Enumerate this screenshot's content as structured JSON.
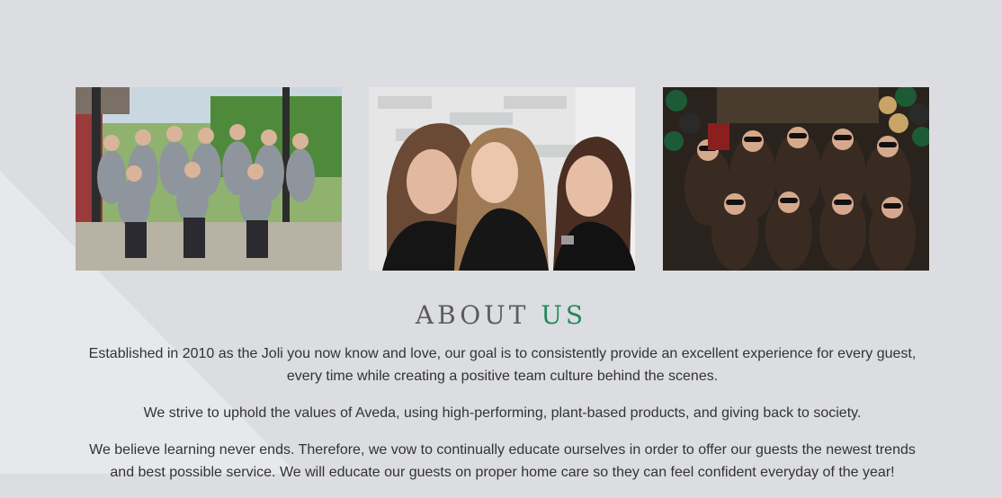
{
  "gallery": {
    "photos": [
      {
        "alt": "team-outdoor-group-photo"
      },
      {
        "alt": "three-stylists-laughing-photo"
      },
      {
        "alt": "masquerade-party-group-photo"
      }
    ]
  },
  "about": {
    "title_word1": "ABOUT",
    "title_word2": "US",
    "accent_color": "#1f8a5c",
    "paragraphs": [
      "Established in 2010 as the Joli you now know and love, our goal is to consistently provide an excellent experience for every guest, every time while creating a positive team culture behind the scenes.",
      "We strive to uphold the values of Aveda, using high-performing, plant-based products, and giving back to society.",
      "We believe learning never ends. Therefore, we vow to continually educate ourselves in order to offer our guests the newest trends and best possible service. We will educate our guests on proper home care so they can feel confident everyday of the year!"
    ]
  }
}
